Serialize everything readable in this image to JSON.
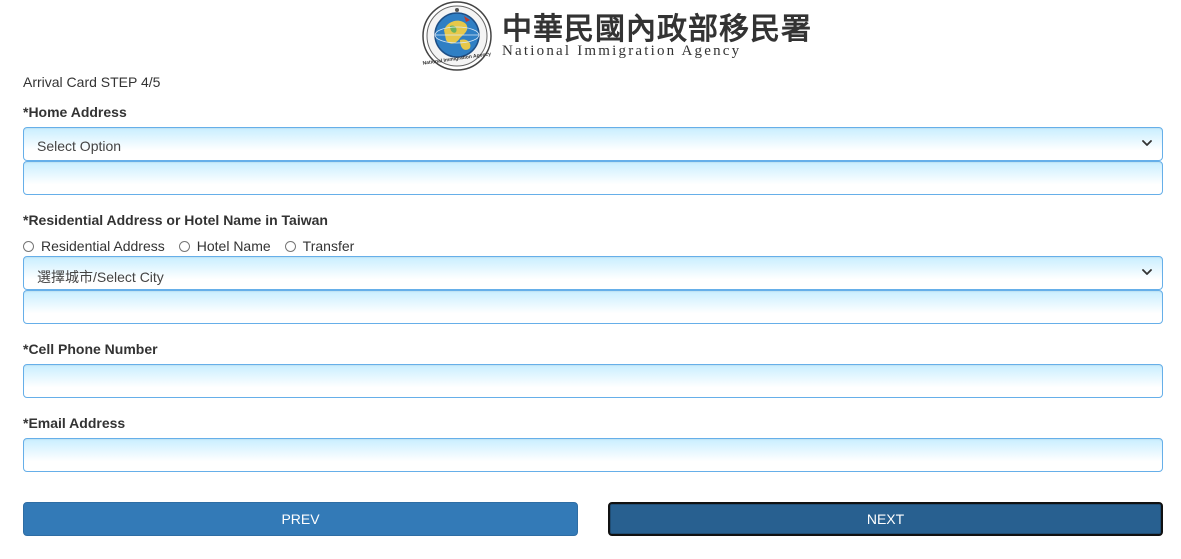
{
  "header": {
    "agency_name_zh": "中華民國內政部移民署",
    "agency_name_en": "National Immigration Agency",
    "emblem_text": "National Immigration Agency"
  },
  "form": {
    "step_title": "Arrival Card STEP 4/5",
    "home_address": {
      "label": "*Home Address",
      "select_value": "Select Option",
      "input_value": ""
    },
    "residential": {
      "label": "*Residential Address or Hotel Name in Taiwan",
      "options": [
        "Residential Address",
        "Hotel Name",
        "Transfer"
      ],
      "select_value": "選擇城市/Select City",
      "input_value": ""
    },
    "cell_phone": {
      "label": "*Cell Phone Number",
      "input_value": ""
    },
    "email": {
      "label": "*Email Address",
      "input_value": ""
    }
  },
  "buttons": {
    "prev_label": "PREV",
    "next_label": "NEXT"
  },
  "colors": {
    "primary": "#337ab7",
    "primary_active": "#286090",
    "input_border": "#66afe9",
    "input_gradient_top": "#c9eeff"
  }
}
